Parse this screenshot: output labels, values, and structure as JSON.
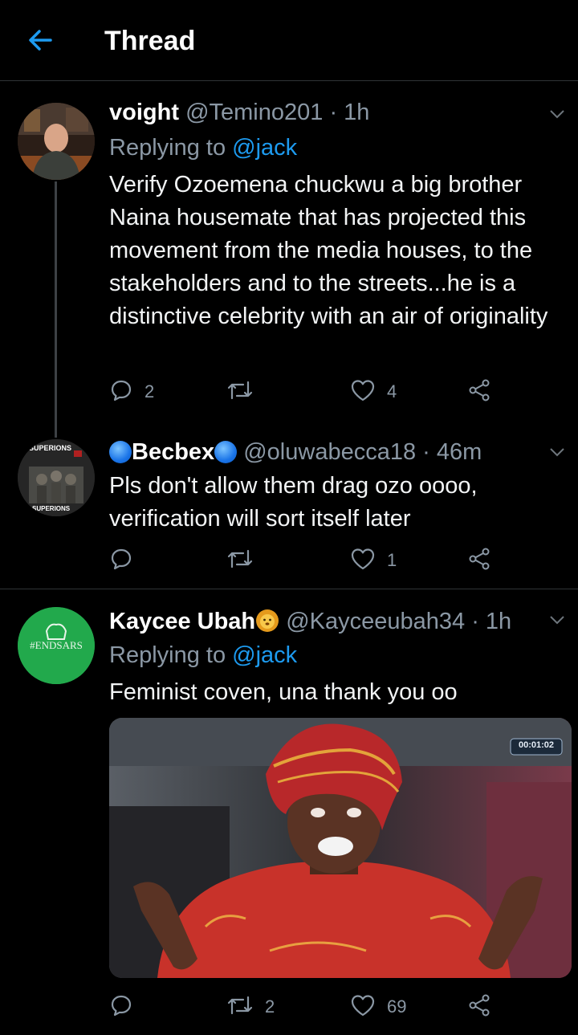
{
  "header": {
    "title": "Thread"
  },
  "icons": {
    "back": "back-arrow-icon",
    "reply": "reply-icon",
    "retweet": "retweet-icon",
    "like": "heart-icon",
    "share": "share-icon",
    "more": "chevron-down-icon"
  },
  "colors": {
    "accent": "#1d9bf0",
    "muted": "#8b98a5",
    "background": "#000000"
  },
  "tweets": [
    {
      "name": "voight",
      "handle": "@Temino201",
      "time": "· 1h",
      "replying_label": "Replying to",
      "replying_to": "@jack",
      "text": "Verify Ozoemena chuckwu a big brother Naina housemate that has projected this movement from the media houses, to the stakeholders and to the streets...he is a distinctive celebrity with an air of originality",
      "replies": "2",
      "retweets": "",
      "likes": "4"
    },
    {
      "name": "Becbex",
      "handle": "@oluwabecca18",
      "time": "· 46m",
      "text": "Pls don't allow them drag ozo oooo, verification will sort itself later",
      "replies": "",
      "retweets": "",
      "likes": "1",
      "avatar_text_top": "SUPERIONS",
      "avatar_text_bottom": "SUPERIONS"
    },
    {
      "name": "Kaycee Ubah",
      "handle": "@Kayceeubah34",
      "time": "· 1h",
      "replying_label": "Replying to",
      "replying_to": "@jack",
      "text": "Feminist coven, una thank you oo",
      "replies": "",
      "retweets": "2",
      "likes": "69",
      "avatar_text": "#ENDSARS",
      "media_timestamp": "00:01:02"
    }
  ]
}
